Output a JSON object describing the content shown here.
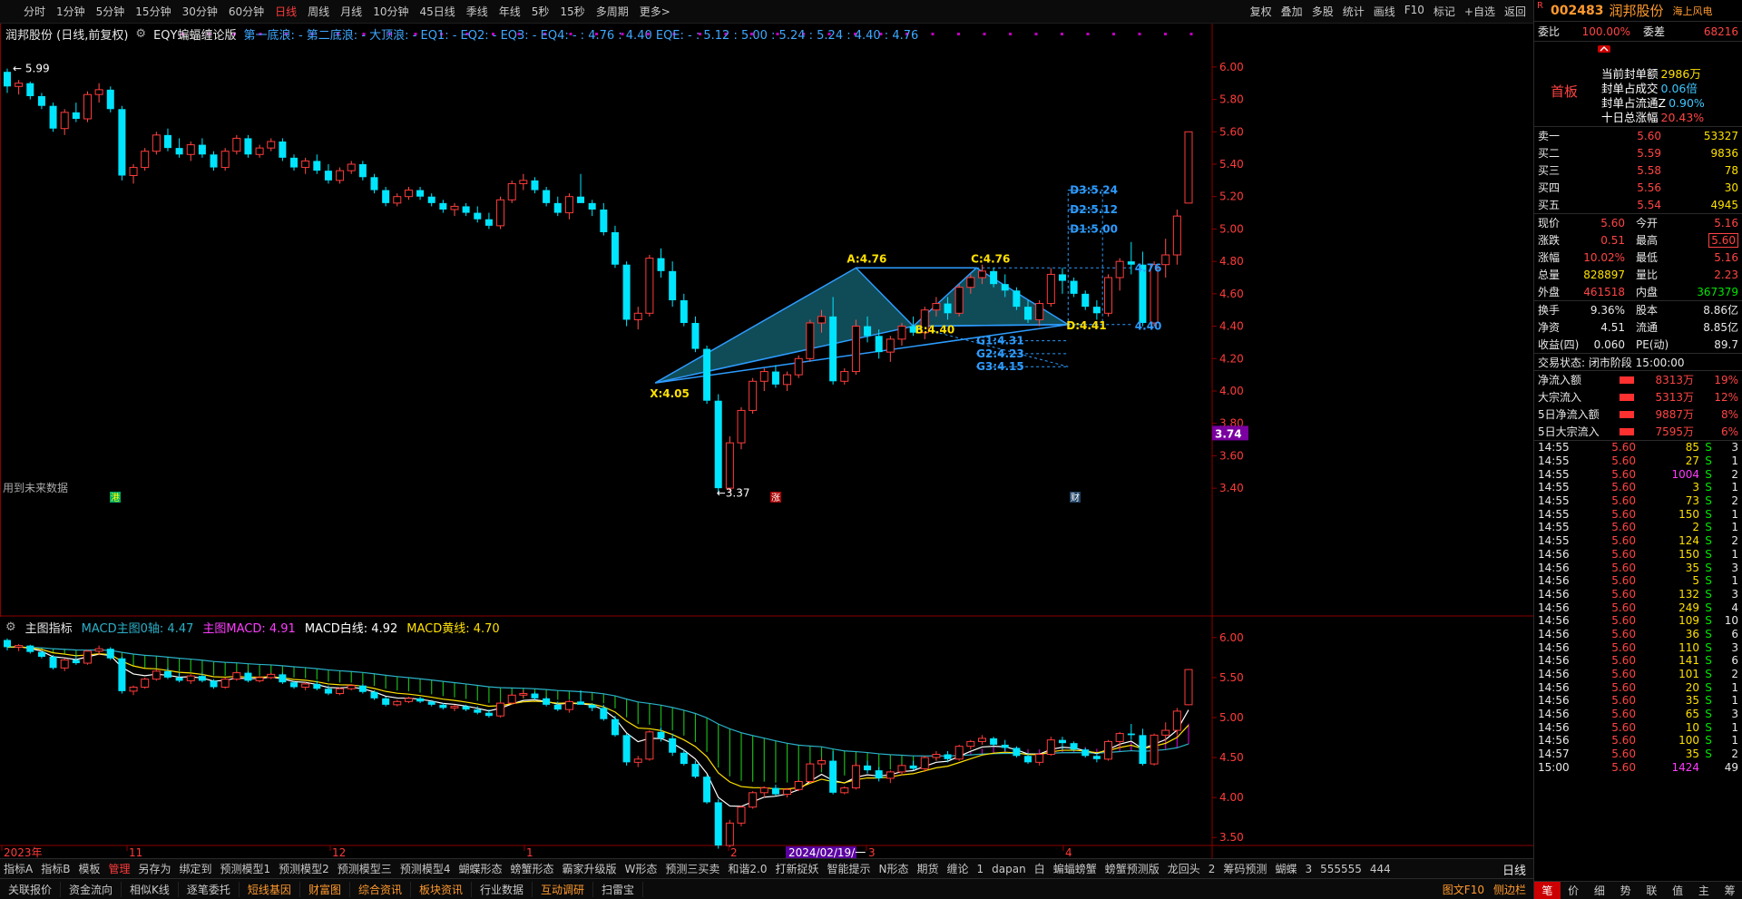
{
  "topbar": {
    "period_tabs": [
      "分时",
      "1分钟",
      "5分钟",
      "15分钟",
      "30分钟",
      "60分钟",
      "日线",
      "周线",
      "月线",
      "10分钟",
      "45日线",
      "季线",
      "年线",
      "5秒",
      "15秒",
      "多周期",
      "更多>"
    ],
    "active_tab": "日线",
    "right_tools": [
      "复权",
      "叠加",
      "多股",
      "统计",
      "画线",
      "F10",
      "标记",
      "+自选",
      "返回"
    ]
  },
  "main_chart": {
    "title": "润邦股份 (日线,前复权)",
    "indicator_name": "EQY蝙蝠缠论版",
    "eq_text": "第一底浪: - 第二底浪: - 大顶浪: - EQ1: - EQ2: - EQ3: - EQ4: - : 4.76 : 4.40  EQE: - : 5.12 : 5.00 : 5.24 : 5.24 : 4.40 : 4.76",
    "price_axis": [
      "6.00",
      "5.80",
      "5.60",
      "5.40",
      "5.20",
      "5.00",
      "4.80",
      "4.60",
      "4.40",
      "4.20",
      "4.00",
      "3.80",
      "3.60",
      "3.40"
    ],
    "current_price_tag": "3.74",
    "high_label": "5.99",
    "low_label": "3.37",
    "future_data_note": "用到未来数据",
    "pattern_labels": {
      "X": "X:4.05",
      "A": "A:4.76",
      "B": "B:4.40",
      "C": "C:4.76",
      "D": "D:4.41",
      "G1": "G1:4.31",
      "G2": "G2:4.23",
      "G3": "G3:4.15",
      "D1": "D1:5.00",
      "D2": "D2:5.12",
      "D3": "D3:5.24",
      "right_476": "4.76",
      "right_440": "4.40"
    },
    "markers": {
      "m1": "港",
      "m2": "涨",
      "m3": "财"
    }
  },
  "sub_chart": {
    "title": "主图指标",
    "macd0": "MACD主图0轴: 4.47",
    "macd": "主图MACD: 4.91",
    "white_line": "MACD白线: 4.92",
    "yellow_line": "MACD黄线: 4.70",
    "price_axis": [
      "6.00",
      "5.50",
      "5.00",
      "4.50",
      "4.00",
      "3.50"
    ],
    "date_labels": {
      "y2023": "2023年",
      "m11": "11",
      "m12": "12",
      "m1": "1",
      "m2": "2",
      "cursor": "2024/02/19/一",
      "m3": "3",
      "m4": "4"
    }
  },
  "indicator_tabs": [
    "指标A",
    "指标B",
    "模板",
    "管理",
    "另存为",
    "绑定到",
    "预测模型1",
    "预测模型2",
    "预测模型三",
    "预测模型4",
    "蝴蝶形态",
    "螃蟹形态",
    "霸家升级版",
    "W形态",
    "预测三买卖",
    "和谐2.0",
    "打新捉妖",
    "智能提示",
    "N形态",
    "期货",
    "缠论",
    "1",
    "dapan",
    "白",
    "蝙蝠螃蟹",
    "螃蟹预测版",
    "龙回头",
    "2",
    "筹码预测",
    "蝴蝶",
    "3",
    "555555",
    "444"
  ],
  "indicator_active": "管理",
  "day_label": "日线",
  "bottom_tabs": [
    "关联报价",
    "资金流向",
    "相似K线",
    "逐笔委托",
    "短线基因",
    "财富图",
    "综合资讯",
    "板块资讯",
    "行业数据",
    "互动调研",
    "扫雷宝"
  ],
  "bottom_hl": [
    "短线基因",
    "财富图",
    "综合资讯",
    "板块资讯",
    "互动调研"
  ],
  "bottom_right": [
    "图文F10",
    "侧边栏"
  ],
  "right_panel": {
    "r": "R",
    "code": "002483",
    "name": "润邦股份",
    "concept": "海上风电",
    "commit": {
      "k1": "委比",
      "v1": "100.00%",
      "k2": "委差",
      "v2": "68216"
    },
    "first_board": "首板",
    "seal": [
      {
        "k": "当前封单额",
        "v": "2986万",
        "c": "yellow"
      },
      {
        "k": "封单占成交",
        "v": "0.06倍",
        "c": "cyan"
      },
      {
        "k": "封单占流通Z",
        "v": "0.90%",
        "c": "cyan"
      },
      {
        "k": "十日总涨幅",
        "v": "20.43%",
        "c": "red"
      }
    ],
    "book": [
      {
        "k": "卖一",
        "p": "5.60",
        "v": "53327"
      },
      {
        "k": "买二",
        "p": "5.59",
        "v": "9836"
      },
      {
        "k": "买三",
        "p": "5.58",
        "v": "78"
      },
      {
        "k": "买四",
        "p": "5.56",
        "v": "30"
      },
      {
        "k": "买五",
        "p": "5.54",
        "v": "4945"
      }
    ],
    "stats": [
      {
        "k1": "现价",
        "v1": "5.60",
        "c1": "red",
        "k2": "今开",
        "v2": "5.16",
        "c2": "red"
      },
      {
        "k1": "涨跌",
        "v1": "0.51",
        "c1": "red",
        "k2": "最高",
        "v2": "5.60",
        "c2": "red"
      },
      {
        "k1": "涨幅",
        "v1": "10.02%",
        "c1": "red",
        "k2": "最低",
        "v2": "5.16",
        "c2": "red"
      },
      {
        "k1": "总量",
        "v1": "828897",
        "c1": "yellow",
        "k2": "量比",
        "v2": "2.23",
        "c2": "red"
      },
      {
        "k1": "外盘",
        "v1": "461518",
        "c1": "red",
        "k2": "内盘",
        "v2": "367379",
        "c2": "green"
      }
    ],
    "stats2": [
      {
        "k1": "换手",
        "v1": "9.36%",
        "k2": "股本",
        "v2": "8.86亿"
      },
      {
        "k1": "净资",
        "v1": "4.51",
        "k2": "流通",
        "v2": "8.85亿"
      },
      {
        "k1": "收益(四)",
        "v1": "0.060",
        "k2": "PE(动)",
        "v2": "89.7"
      }
    ],
    "trade_state": "交易状态: 闭市阶段 15:00:00",
    "flows": [
      {
        "k": "净流入额",
        "v": "8313万",
        "p": "19%"
      },
      {
        "k": "大宗流入",
        "v": "5313万",
        "p": "12%"
      },
      {
        "k": "5日净流入额",
        "v": "9887万",
        "p": "8%"
      },
      {
        "k": "5日大宗流入",
        "v": "7595万",
        "p": "6%"
      }
    ],
    "ticks": [
      {
        "t": "14:55",
        "p": "5.60",
        "v": "85",
        "s": "S",
        "n": "3",
        "c": "yellow"
      },
      {
        "t": "14:55",
        "p": "5.60",
        "v": "27",
        "s": "S",
        "n": "1",
        "c": "yellow"
      },
      {
        "t": "14:55",
        "p": "5.60",
        "v": "1004",
        "s": "S",
        "n": "2",
        "c": "magenta"
      },
      {
        "t": "14:55",
        "p": "5.60",
        "v": "3",
        "s": "S",
        "n": "1",
        "c": "yellow"
      },
      {
        "t": "14:55",
        "p": "5.60",
        "v": "73",
        "s": "S",
        "n": "2",
        "c": "yellow"
      },
      {
        "t": "14:55",
        "p": "5.60",
        "v": "150",
        "s": "S",
        "n": "1",
        "c": "yellow"
      },
      {
        "t": "14:55",
        "p": "5.60",
        "v": "2",
        "s": "S",
        "n": "1",
        "c": "yellow"
      },
      {
        "t": "14:55",
        "p": "5.60",
        "v": "124",
        "s": "S",
        "n": "2",
        "c": "yellow"
      },
      {
        "t": "14:56",
        "p": "5.60",
        "v": "150",
        "s": "S",
        "n": "1",
        "c": "yellow"
      },
      {
        "t": "14:56",
        "p": "5.60",
        "v": "35",
        "s": "S",
        "n": "3",
        "c": "yellow"
      },
      {
        "t": "14:56",
        "p": "5.60",
        "v": "5",
        "s": "S",
        "n": "1",
        "c": "yellow"
      },
      {
        "t": "14:56",
        "p": "5.60",
        "v": "132",
        "s": "S",
        "n": "3",
        "c": "yellow"
      },
      {
        "t": "14:56",
        "p": "5.60",
        "v": "249",
        "s": "S",
        "n": "4",
        "c": "yellow"
      },
      {
        "t": "14:56",
        "p": "5.60",
        "v": "109",
        "s": "S",
        "n": "10",
        "c": "yellow"
      },
      {
        "t": "14:56",
        "p": "5.60",
        "v": "36",
        "s": "S",
        "n": "6",
        "c": "yellow"
      },
      {
        "t": "14:56",
        "p": "5.60",
        "v": "110",
        "s": "S",
        "n": "3",
        "c": "yellow"
      },
      {
        "t": "14:56",
        "p": "5.60",
        "v": "141",
        "s": "S",
        "n": "6",
        "c": "yellow"
      },
      {
        "t": "14:56",
        "p": "5.60",
        "v": "101",
        "s": "S",
        "n": "2",
        "c": "yellow"
      },
      {
        "t": "14:56",
        "p": "5.60",
        "v": "20",
        "s": "S",
        "n": "1",
        "c": "yellow"
      },
      {
        "t": "14:56",
        "p": "5.60",
        "v": "35",
        "s": "S",
        "n": "1",
        "c": "yellow"
      },
      {
        "t": "14:56",
        "p": "5.60",
        "v": "65",
        "s": "S",
        "n": "3",
        "c": "yellow"
      },
      {
        "t": "14:56",
        "p": "5.60",
        "v": "10",
        "s": "S",
        "n": "1",
        "c": "yellow"
      },
      {
        "t": "14:56",
        "p": "5.60",
        "v": "100",
        "s": "S",
        "n": "1",
        "c": "yellow"
      },
      {
        "t": "14:57",
        "p": "5.60",
        "v": "35",
        "s": "S",
        "n": "2",
        "c": "yellow"
      },
      {
        "t": "15:00",
        "p": "5.60",
        "v": "1424",
        "s": "",
        "n": "49",
        "c": "magenta"
      }
    ],
    "bottom": [
      "笔",
      "价",
      "细",
      "势",
      "联",
      "值",
      "主",
      "筹"
    ]
  },
  "chart_data": {
    "type": "candlestick",
    "title": "润邦股份 (日线,前复权)",
    "y_range": [
      3.3,
      6.1
    ],
    "ohlc": [
      [
        5.97,
        5.99,
        5.84,
        5.88
      ],
      [
        5.88,
        5.92,
        5.83,
        5.9
      ],
      [
        5.9,
        5.91,
        5.8,
        5.82
      ],
      [
        5.82,
        5.84,
        5.74,
        5.76
      ],
      [
        5.76,
        5.78,
        5.6,
        5.62
      ],
      [
        5.62,
        5.74,
        5.58,
        5.72
      ],
      [
        5.72,
        5.78,
        5.66,
        5.68
      ],
      [
        5.68,
        5.85,
        5.66,
        5.83
      ],
      [
        5.83,
        5.9,
        5.78,
        5.86
      ],
      [
        5.86,
        5.88,
        5.72,
        5.74
      ],
      [
        5.74,
        5.76,
        5.3,
        5.33
      ],
      [
        5.33,
        5.4,
        5.28,
        5.38
      ],
      [
        5.38,
        5.5,
        5.36,
        5.48
      ],
      [
        5.48,
        5.6,
        5.46,
        5.58
      ],
      [
        5.58,
        5.62,
        5.48,
        5.5
      ],
      [
        5.5,
        5.56,
        5.44,
        5.46
      ],
      [
        5.46,
        5.54,
        5.42,
        5.52
      ],
      [
        5.52,
        5.56,
        5.44,
        5.46
      ],
      [
        5.46,
        5.48,
        5.36,
        5.38
      ],
      [
        5.38,
        5.5,
        5.36,
        5.48
      ],
      [
        5.48,
        5.58,
        5.46,
        5.56
      ],
      [
        5.56,
        5.58,
        5.44,
        5.46
      ],
      [
        5.46,
        5.52,
        5.44,
        5.5
      ],
      [
        5.5,
        5.56,
        5.48,
        5.54
      ],
      [
        5.54,
        5.56,
        5.42,
        5.44
      ],
      [
        5.44,
        5.46,
        5.36,
        5.38
      ],
      [
        5.38,
        5.44,
        5.34,
        5.42
      ],
      [
        5.42,
        5.46,
        5.34,
        5.36
      ],
      [
        5.36,
        5.4,
        5.28,
        5.3
      ],
      [
        5.3,
        5.38,
        5.28,
        5.36
      ],
      [
        5.36,
        5.42,
        5.34,
        5.4
      ],
      [
        5.4,
        5.42,
        5.3,
        5.32
      ],
      [
        5.32,
        5.34,
        5.22,
        5.24
      ],
      [
        5.24,
        5.26,
        5.14,
        5.16
      ],
      [
        5.16,
        5.22,
        5.14,
        5.2
      ],
      [
        5.2,
        5.26,
        5.18,
        5.24
      ],
      [
        5.24,
        5.26,
        5.18,
        5.2
      ],
      [
        5.2,
        5.22,
        5.14,
        5.16
      ],
      [
        5.16,
        5.18,
        5.1,
        5.12
      ],
      [
        5.12,
        5.16,
        5.08,
        5.14
      ],
      [
        5.14,
        5.16,
        5.08,
        5.1
      ],
      [
        5.1,
        5.14,
        5.04,
        5.06
      ],
      [
        5.06,
        5.1,
        5.0,
        5.02
      ],
      [
        5.02,
        5.2,
        5.0,
        5.18
      ],
      [
        5.18,
        5.3,
        5.16,
        5.28
      ],
      [
        5.28,
        5.34,
        5.24,
        5.3
      ],
      [
        5.3,
        5.32,
        5.22,
        5.24
      ],
      [
        5.24,
        5.26,
        5.14,
        5.16
      ],
      [
        5.16,
        5.2,
        5.08,
        5.1
      ],
      [
        5.1,
        5.22,
        5.06,
        5.2
      ],
      [
        5.2,
        5.34,
        5.18,
        5.16
      ],
      [
        5.16,
        5.18,
        5.08,
        5.12
      ],
      [
        5.12,
        5.16,
        4.96,
        4.98
      ],
      [
        4.98,
        5.02,
        4.76,
        4.78
      ],
      [
        4.78,
        4.8,
        4.4,
        4.44
      ],
      [
        4.44,
        4.52,
        4.38,
        4.48
      ],
      [
        4.48,
        4.84,
        4.46,
        4.82
      ],
      [
        4.82,
        4.88,
        4.7,
        4.74
      ],
      [
        4.74,
        4.8,
        4.52,
        4.56
      ],
      [
        4.56,
        4.6,
        4.4,
        4.42
      ],
      [
        4.42,
        4.46,
        4.24,
        4.26
      ],
      [
        4.26,
        4.28,
        3.92,
        3.94
      ],
      [
        3.94,
        3.98,
        3.36,
        3.4
      ],
      [
        3.4,
        3.72,
        3.38,
        3.68
      ],
      [
        3.68,
        3.9,
        3.64,
        3.88
      ],
      [
        3.88,
        4.08,
        3.86,
        4.06
      ],
      [
        4.06,
        4.14,
        4.0,
        4.12
      ],
      [
        4.12,
        4.16,
        4.02,
        4.04
      ],
      [
        4.04,
        4.12,
        4.0,
        4.1
      ],
      [
        4.1,
        4.22,
        4.08,
        4.2
      ],
      [
        4.2,
        4.44,
        4.18,
        4.42
      ],
      [
        4.42,
        4.5,
        4.36,
        4.46
      ],
      [
        4.46,
        4.58,
        4.04,
        4.06
      ],
      [
        4.06,
        4.14,
        4.04,
        4.12
      ],
      [
        4.12,
        4.44,
        4.1,
        4.4
      ],
      [
        4.4,
        4.46,
        4.3,
        4.34
      ],
      [
        4.34,
        4.38,
        4.2,
        4.24
      ],
      [
        4.24,
        4.34,
        4.18,
        4.32
      ],
      [
        4.32,
        4.42,
        4.28,
        4.4
      ],
      [
        4.4,
        4.46,
        4.34,
        4.36
      ],
      [
        4.36,
        4.52,
        4.32,
        4.5
      ],
      [
        4.5,
        4.58,
        4.46,
        4.54
      ],
      [
        4.54,
        4.58,
        4.44,
        4.48
      ],
      [
        4.48,
        4.66,
        4.46,
        4.64
      ],
      [
        4.64,
        4.72,
        4.6,
        4.7
      ],
      [
        4.7,
        4.78,
        4.66,
        4.74
      ],
      [
        4.74,
        4.76,
        4.64,
        4.66
      ],
      [
        4.66,
        4.72,
        4.58,
        4.62
      ],
      [
        4.62,
        4.64,
        4.5,
        4.52
      ],
      [
        4.52,
        4.56,
        4.42,
        4.44
      ],
      [
        4.44,
        4.56,
        4.4,
        4.54
      ],
      [
        4.54,
        4.76,
        4.52,
        4.72
      ],
      [
        4.72,
        4.76,
        4.6,
        4.68
      ],
      [
        4.68,
        4.7,
        4.58,
        4.6
      ],
      [
        4.6,
        4.62,
        4.5,
        4.52
      ],
      [
        4.52,
        4.56,
        4.44,
        4.48
      ],
      [
        4.48,
        4.72,
        4.46,
        4.7
      ],
      [
        4.7,
        4.82,
        4.62,
        4.8
      ],
      [
        4.8,
        4.92,
        4.72,
        4.78
      ],
      [
        4.78,
        4.86,
        4.4,
        4.42
      ],
      [
        4.42,
        4.8,
        4.4,
        4.78
      ],
      [
        4.78,
        4.94,
        4.7,
        4.84
      ],
      [
        4.84,
        5.12,
        4.78,
        5.08
      ],
      [
        5.16,
        5.6,
        5.16,
        5.6
      ]
    ]
  }
}
